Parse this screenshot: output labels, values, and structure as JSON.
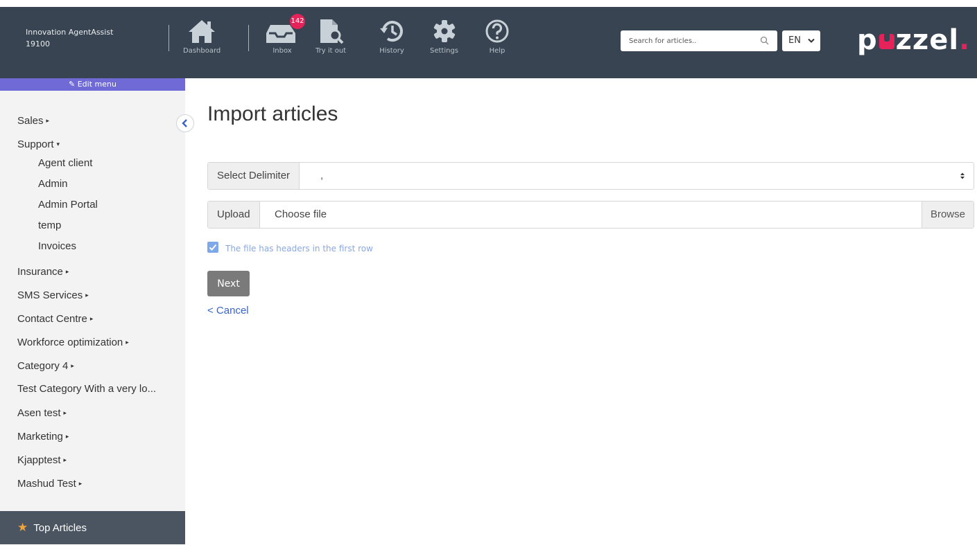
{
  "header": {
    "brand_line1": "Innovation AgentAssist",
    "brand_line2": "19100",
    "nav": {
      "dashboard": "Dashboard",
      "inbox": "Inbox",
      "inbox_badge": "142",
      "try_it_out": "Try it out",
      "history": "History",
      "settings": "Settings",
      "help": "Help"
    },
    "search_placeholder": "Search for articles..",
    "language": "EN",
    "logo_left": "p",
    "logo_right": "zzel",
    "logo_dot": ".",
    "colors": {
      "bar": "#384451",
      "accent": "#e5225a"
    }
  },
  "sidebar": {
    "edit_menu": "Edit menu",
    "categories": [
      {
        "label": "Sales",
        "arrow": "▸"
      },
      {
        "label": "Support",
        "arrow": "▾"
      },
      {
        "label": "Insurance",
        "arrow": "▸"
      },
      {
        "label": "SMS Services",
        "arrow": "▸"
      },
      {
        "label": "Contact Centre",
        "arrow": "▸"
      },
      {
        "label": "Workforce optimization",
        "arrow": "▸"
      },
      {
        "label": "Category 4",
        "arrow": "▸"
      },
      {
        "label": "Test Category With a very lo...",
        "arrow": ""
      },
      {
        "label": "Asen test",
        "arrow": "▸"
      },
      {
        "label": "Marketing",
        "arrow": "▸"
      },
      {
        "label": "Kjapptest",
        "arrow": "▸"
      },
      {
        "label": "Mashud Test",
        "arrow": "▸"
      }
    ],
    "support_children": [
      "Agent client",
      "Admin",
      "Admin Portal",
      "temp",
      "Invoices"
    ],
    "top_articles": "Top Articles"
  },
  "main": {
    "title": "Import articles",
    "delimiter_label": "Select Delimiter",
    "delimiter_value": ",",
    "upload_label": "Upload",
    "file_value": "Choose file",
    "browse_label": "Browse",
    "headers_checkbox_label": "The file has headers in the first row",
    "headers_checked": true,
    "next_label": "Next",
    "cancel_label": "< Cancel"
  }
}
